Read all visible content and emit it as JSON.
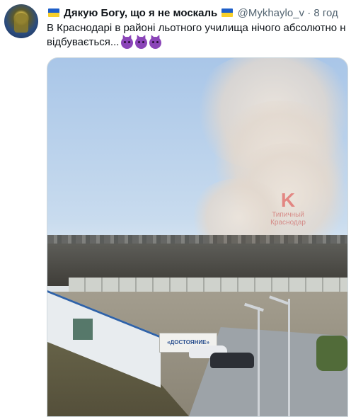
{
  "tweet": {
    "display_name": "Дякую Богу, що я не москаль",
    "handle": "@Mykhaylo_v",
    "separator": "·",
    "time": "8 год",
    "text_line1": "В Краснодарі в районі льотного училища нічого абсолютно н",
    "text_line2": "відбувається...",
    "emoji_count": 3
  },
  "media": {
    "watermark_logo": "K",
    "watermark_line1": "Типичный",
    "watermark_line2": "Краснодар",
    "banner_sign": "«ДОСТОЯНИЕ»"
  },
  "colors": {
    "text": "#0f1419",
    "secondary": "#536471",
    "flag_blue": "#1e5ec8",
    "flag_yellow": "#f7cf2a",
    "devil_purple": "#8b45b8"
  }
}
